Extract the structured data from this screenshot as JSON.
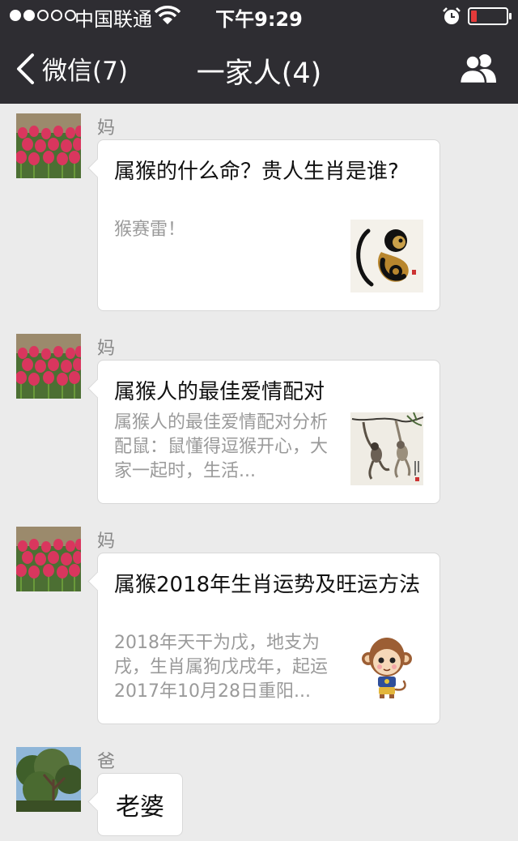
{
  "status_bar": {
    "carrier": "中国联通",
    "time": "下午9:29"
  },
  "nav": {
    "back_label": "微信(7)",
    "title": "一家人(4)"
  },
  "messages": [
    {
      "sender": "妈",
      "title": "属猴的什么命？贵人生肖是谁?",
      "description": "猴赛雷！",
      "thumb_icon": "ink-monkey-icon"
    },
    {
      "sender": "妈",
      "title": "属猴人的最佳爱情配对",
      "description": "属猴人的最佳爱情配对分析配鼠：鼠懂得逗猴开心，大家一起时，生活...",
      "thumb_icon": "gibbon-painting-icon"
    },
    {
      "sender": "妈",
      "title": "属猴2018年生肖运势及旺运方法",
      "description": "2018年天干为戊，地支为戌，生肖属狗戊戌年，起运2017年10月28日重阳...",
      "thumb_icon": "cartoon-monkey-icon"
    },
    {
      "sender": "爸",
      "text": "老婆"
    }
  ],
  "colors": {
    "nav_background": "#2e2d32",
    "chat_background": "#ebebeb",
    "battery_low": "#e43a3a"
  }
}
